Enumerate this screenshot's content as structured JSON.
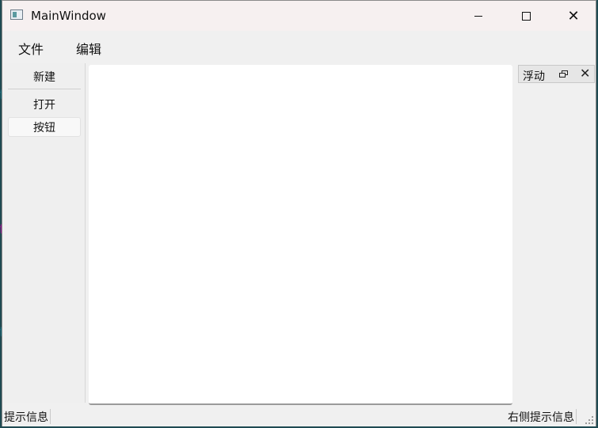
{
  "window": {
    "title": "MainWindow"
  },
  "menu": {
    "file": "文件",
    "edit": "编辑"
  },
  "toolbar": {
    "new_label": "新建",
    "open_label": "打开",
    "button_label": "按钮"
  },
  "dock": {
    "title": "浮动"
  },
  "status": {
    "left": "提示信息",
    "right": "右侧提示信息"
  },
  "icons": {
    "app": "window-icon",
    "minimize": "minimize-icon",
    "maximize": "maximize-icon",
    "close": "close-icon",
    "dock_float": "float-icon",
    "dock_close": "close-icon",
    "grip": "size-grip-icon"
  }
}
